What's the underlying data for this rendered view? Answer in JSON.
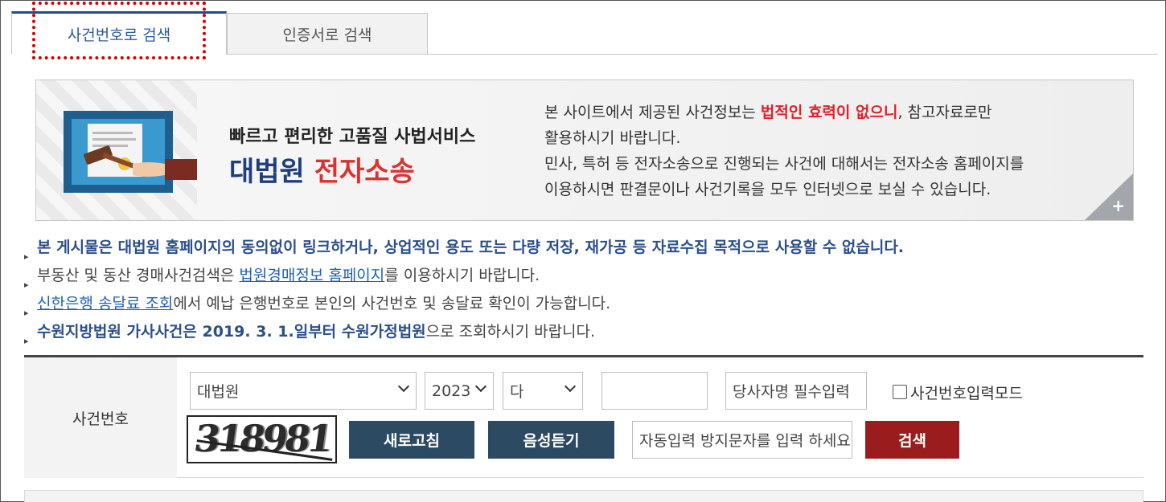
{
  "tabs": [
    {
      "label": "사건번호로 검색",
      "active": true
    },
    {
      "label": "인증서로 검색",
      "active": false
    }
  ],
  "banner": {
    "subtitle": "빠르고 편리한 고품질 사법서비스",
    "title_main": "대법원",
    "title_accent": "전자소송",
    "notice_line1_prefix": "본 사이트에서 제공된 사건정보는 ",
    "notice_line1_warn": "법적인 효력이 없으니",
    "notice_line1_suffix": ", 참고자료로만",
    "notice_line2": "활용하시기 바랍니다.",
    "notice_line3": "민사, 특허 등 전자소송으로 진행되는 사건에 대해서는 전자소송 홈페이지를",
    "notice_line4": "이용하시면 판결문이나 사건기록을 모두 인터넷으로 보실 수 있습니다.",
    "more_label": "+"
  },
  "notices": {
    "n1": "본 게시물은 대법원 홈페이지의 동의없이 링크하거나, 상업적인 용도 또는 다량 저장, 재가공 등 자료수집 목적으로 사용할 수 없습니다.",
    "n2_prefix": "부동산 및 동산 경매사건검색은 ",
    "n2_link": "법원경매정보 홈페이지",
    "n2_suffix": "를 이용하시기 바랍니다.",
    "n3_link": "신한은행 송달료 조회",
    "n3_suffix": "에서 예납 은행번호로 본인의 사건번호 및 송달료 확인이 가능합니다.",
    "n4_bold": "수원지방법원 가사사건은 2019. 3. 1.일부터 수원가정법원",
    "n4_suffix": "으로 조회하시기 바랍니다."
  },
  "search": {
    "label": "사건번호",
    "court_select": "대법원",
    "year_select": "2023",
    "type_select": "다",
    "case_number_value": "",
    "party_name_placeholder": "당사자명 필수입력",
    "mode_checkbox_label": "사건번호입력모드",
    "mode_checkbox_checked": false,
    "captcha_text": "318981",
    "refresh_button": "새로고침",
    "audio_button": "음성듣기",
    "captcha_input_placeholder": "자동입력 방지문자를 입력 하세요",
    "search_button": "검색"
  },
  "colors": {
    "tab_active_text": "#2a5aa0",
    "highlight_border": "#d10000",
    "banner_title": "#1f3f7a",
    "banner_accent": "#d93333",
    "warn_text": "#e0202a",
    "notice_bold": "#2b4f8a",
    "button_navy": "#2d4a63",
    "button_red": "#9b1c1c"
  }
}
